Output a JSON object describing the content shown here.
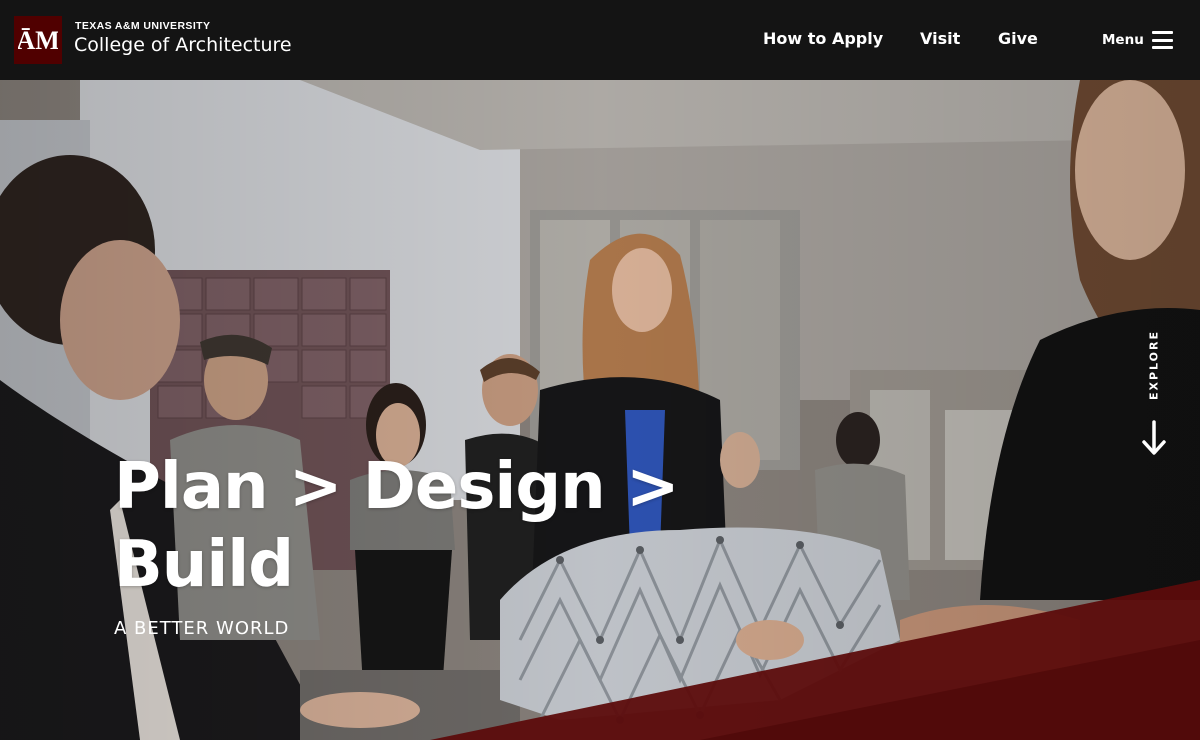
{
  "header": {
    "logo_icon": "atm-logo-icon",
    "university": "TEXAS A&M UNIVERSITY",
    "college": "College of Architecture",
    "nav": [
      {
        "label": "How to Apply"
      },
      {
        "label": "Visit"
      },
      {
        "label": "Give"
      }
    ],
    "menu_label": "Menu",
    "menu_icon": "hamburger-icon"
  },
  "hero": {
    "title_line1": "Plan > Design >",
    "title_line2": "Build",
    "subtitle": "A BETTER WORLD",
    "explore_label": "EXPLORE",
    "explore_icon": "arrow-down-icon"
  },
  "colors": {
    "header_bg": "#141414",
    "brand_maroon": "#500000",
    "band_maroon": "#6b1010",
    "text": "#ffffff"
  }
}
